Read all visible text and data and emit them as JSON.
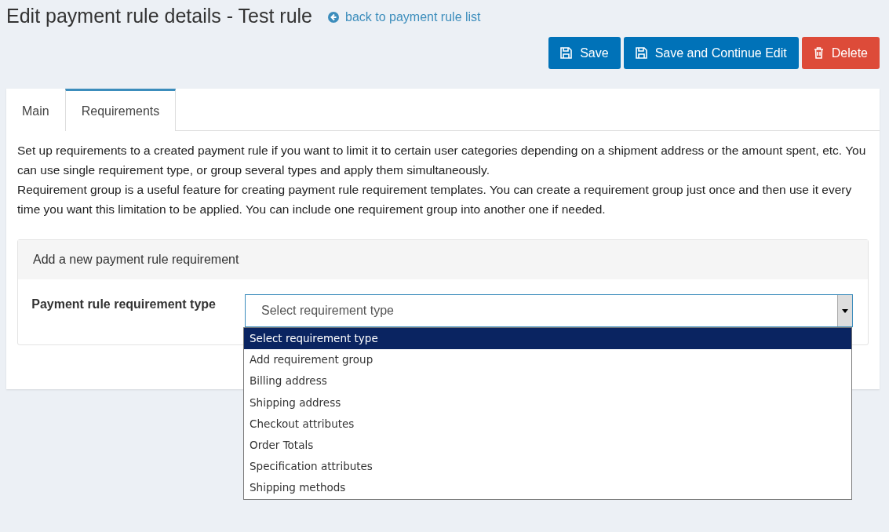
{
  "page": {
    "title": "Edit payment rule details - Test rule",
    "back_link": "back to payment rule list"
  },
  "buttons": [
    {
      "label": "Save",
      "kind": "primary"
    },
    {
      "label": "Save and Continue Edit",
      "kind": "primary"
    },
    {
      "label": "Delete",
      "kind": "danger"
    }
  ],
  "tabs": [
    {
      "label": "Main",
      "selected": false
    },
    {
      "label": "Requirements",
      "selected": true
    }
  ],
  "description": [
    "Set up requirements to a created payment rule if you want to limit it to certain user categories depending on a shipment address or the amount spent, etc. You can use single requirement type, or group several types and apply them simultaneously.",
    "Requirement group is a useful feature for creating payment rule requirement templates. You can create a requirement group just once and then use it every time you want this limitation to be applied. You can include one requirement group into another one if needed."
  ],
  "requirement_card": {
    "header": "Add a new payment rule requirement",
    "field_label": "Payment rule requirement type",
    "select_value": "Select requirement type",
    "expanded": true,
    "options": [
      {
        "label": "Select requirement type",
        "selected": true
      },
      {
        "label": "Add requirement group",
        "selected": false
      },
      {
        "label": "Billing address",
        "selected": false
      },
      {
        "label": "Shipping address",
        "selected": false
      },
      {
        "label": "Checkout attributes",
        "selected": false
      },
      {
        "label": "Order Totals",
        "selected": false
      },
      {
        "label": "Specification attributes",
        "selected": false
      },
      {
        "label": "Shipping methods",
        "selected": false
      }
    ]
  }
}
